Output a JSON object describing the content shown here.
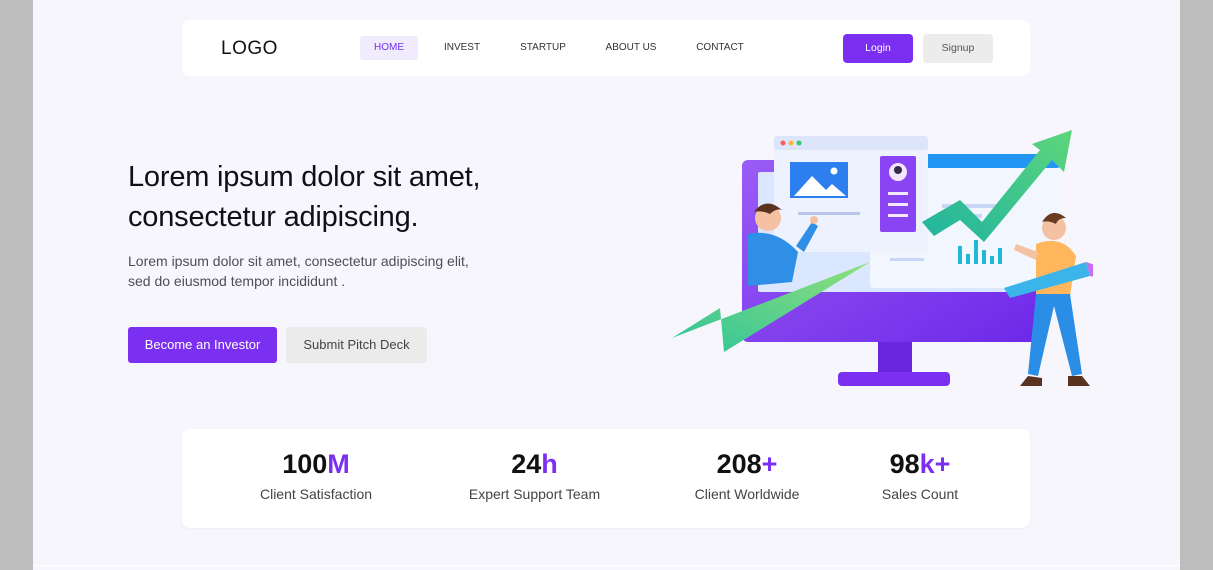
{
  "nav": {
    "logo": "LOGO",
    "items": [
      {
        "label": "HOME",
        "active": true
      },
      {
        "label": "INVEST",
        "active": false
      },
      {
        "label": "STARTUP",
        "active": false
      },
      {
        "label": "ABOUT US",
        "active": false
      },
      {
        "label": "CONTACT",
        "active": false
      }
    ],
    "login_label": "Login",
    "signup_label": "Signup"
  },
  "hero": {
    "title": "Lorem ipsum dolor sit amet, consectetur adipiscing.",
    "subtitle": "Lorem ipsum dolor sit amet, consectetur adipiscing elit, sed do eiusmod tempor incididunt .",
    "primary_button": "Become an Investor",
    "secondary_button": "Submit Pitch Deck"
  },
  "stats": [
    {
      "value": "100",
      "suffix": "M",
      "label": "Client Satisfaction"
    },
    {
      "value": "24",
      "suffix": "h",
      "label": "Expert Support Team"
    },
    {
      "value": "208",
      "suffix": "+",
      "label": "Client Worldwide"
    },
    {
      "value": "98",
      "suffix": "k+",
      "label": "Sales Count"
    }
  ],
  "colors": {
    "accent": "#7a2ff1",
    "page_background": "#f8f6fd",
    "surround": "#bdbdbd"
  }
}
